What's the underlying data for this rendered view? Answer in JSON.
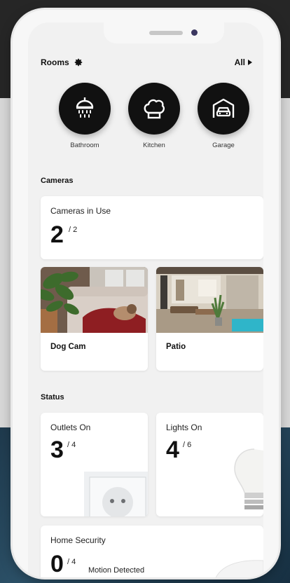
{
  "header": {
    "rooms_label": "Rooms",
    "all_label": "All"
  },
  "rooms": [
    {
      "label": "Bathroom",
      "icon": "shower-icon"
    },
    {
      "label": "Kitchen",
      "icon": "chef-hat-icon"
    },
    {
      "label": "Garage",
      "icon": "garage-car-icon"
    }
  ],
  "cameras": {
    "section_title": "Cameras",
    "in_use": {
      "label": "Cameras in Use",
      "value": "2",
      "total": "/ 2"
    },
    "feeds": [
      {
        "title": "Dog Cam"
      },
      {
        "title": "Patio"
      }
    ]
  },
  "status": {
    "section_title": "Status",
    "outlets": {
      "label": "Outlets On",
      "value": "3",
      "total": "/ 4"
    },
    "lights": {
      "label": "Lights On",
      "value": "4",
      "total": "/ 6"
    },
    "security": {
      "label": "Home Security",
      "value": "0",
      "total": "/ 4",
      "suffix": "Motion Detected"
    }
  },
  "colors": {
    "circle": "#111111",
    "screen": "#f1f1f1",
    "card": "#ffffff"
  }
}
